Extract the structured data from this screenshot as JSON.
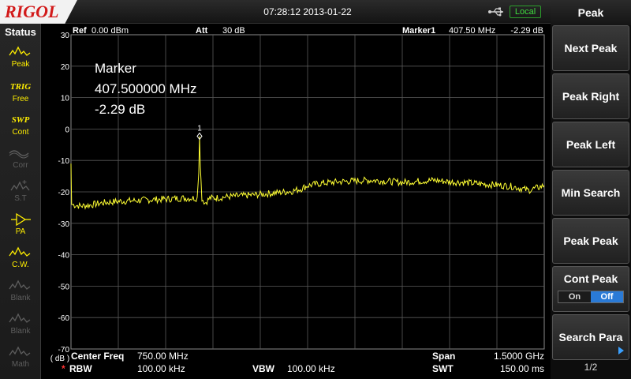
{
  "header": {
    "brand": "RIGOL",
    "datetime": "07:28:12 2013-01-22",
    "remote_state": "Local"
  },
  "status": {
    "title": "Status",
    "items": [
      {
        "label": "Peak",
        "icon": "peak-icon",
        "state": "on"
      },
      {
        "label": "Free",
        "icon": "trig-icon",
        "glyph": "TRIG",
        "state": "on"
      },
      {
        "label": "Cont",
        "icon": "sweep-icon",
        "glyph": "SWP",
        "state": "on"
      },
      {
        "label": "Corr",
        "icon": "correction-icon",
        "state": "off"
      },
      {
        "label": "S.T",
        "icon": "source-tracking-icon",
        "state": "off"
      },
      {
        "label": "PA",
        "icon": "preamp-icon",
        "state": "on"
      },
      {
        "label": "C.W.",
        "icon": "trace-cw-icon",
        "state": "on"
      },
      {
        "label": "Blank",
        "icon": "trace-blank-icon",
        "state": "off"
      },
      {
        "label": "Blank",
        "icon": "trace-blank-icon",
        "state": "off"
      },
      {
        "label": "Math",
        "icon": "math-icon",
        "state": "off"
      }
    ]
  },
  "plot_header": {
    "ref_label": "Ref",
    "ref_value": "0.00 dBm",
    "att_label": "Att",
    "att_value": "30 dB",
    "marker_label": "Marker1",
    "marker_freq": "407.50 MHz",
    "marker_amp": "-2.29 dB"
  },
  "marker_readout": {
    "title": "Marker",
    "freq": "407.500000 MHz",
    "amp": "-2.29 dB",
    "marker_number": "1"
  },
  "y_axis": {
    "labels": [
      "30",
      "20",
      "10",
      "0",
      "-10",
      "-20",
      "-30",
      "-40",
      "-50",
      "-60",
      "-70"
    ],
    "unit": "( dB )",
    "top": 30,
    "bottom": -70
  },
  "bottom_info": {
    "center_label": "Center Freq",
    "center_value": "750.00 MHz",
    "span_label": "Span",
    "span_value": "1.5000 GHz",
    "rbw_star": "*",
    "rbw_label": "RBW",
    "rbw_value": "100.00 kHz",
    "vbw_label": "VBW",
    "vbw_value": "100.00 kHz",
    "swt_label": "SWT",
    "swt_value": "150.00 ms"
  },
  "softkeys": {
    "title": "Peak",
    "next_peak": "Next Peak",
    "peak_right": "Peak Right",
    "peak_left": "Peak Left",
    "min_search": "Min Search",
    "peak_peak": "Peak Peak",
    "cont_peak": "Cont Peak",
    "cont_peak_on": "On",
    "cont_peak_off": "Off",
    "search_para": "Search Para",
    "page": "1/2"
  },
  "colors": {
    "trace": "#ffff33",
    "grid": "#5a5a5a",
    "brand_red": "#d21a1a",
    "local_green": "#3fdc3f",
    "toggle_selected": "#2a7ad6"
  },
  "chart_data": {
    "type": "line",
    "xlim_mhz": [
      0,
      1500
    ],
    "ylim_db": [
      -70,
      30
    ],
    "series": [
      {
        "x": [
          0,
          1,
          2,
          30,
          60,
          100,
          150,
          200,
          250,
          300,
          350,
          390,
          400,
          405,
          407.5,
          410,
          415,
          425,
          440,
          475,
          500,
          550,
          600,
          650,
          700,
          730,
          750,
          780,
          800,
          850,
          900,
          950,
          1000,
          1050,
          1100,
          1150,
          1200,
          1250,
          1300,
          1350,
          1400,
          1430,
          1450,
          1475,
          1500
        ],
        "y": [
          -11,
          -18,
          -24,
          -24.5,
          -24.2,
          -23.5,
          -23,
          -22.8,
          -22.5,
          -22.3,
          -22,
          -22,
          -22,
          -14,
          -2.29,
          -12,
          -22,
          -23.5,
          -22,
          -21.8,
          -21.5,
          -21.2,
          -20.8,
          -20.3,
          -19.8,
          -19,
          -18,
          -17.5,
          -17.2,
          -16.8,
          -16.5,
          -16.3,
          -16.6,
          -17,
          -16.6,
          -16.3,
          -16.8,
          -17,
          -17.5,
          -17.8,
          -18.3,
          -19,
          -19.5,
          -18.8,
          -18
        ]
      }
    ]
  }
}
